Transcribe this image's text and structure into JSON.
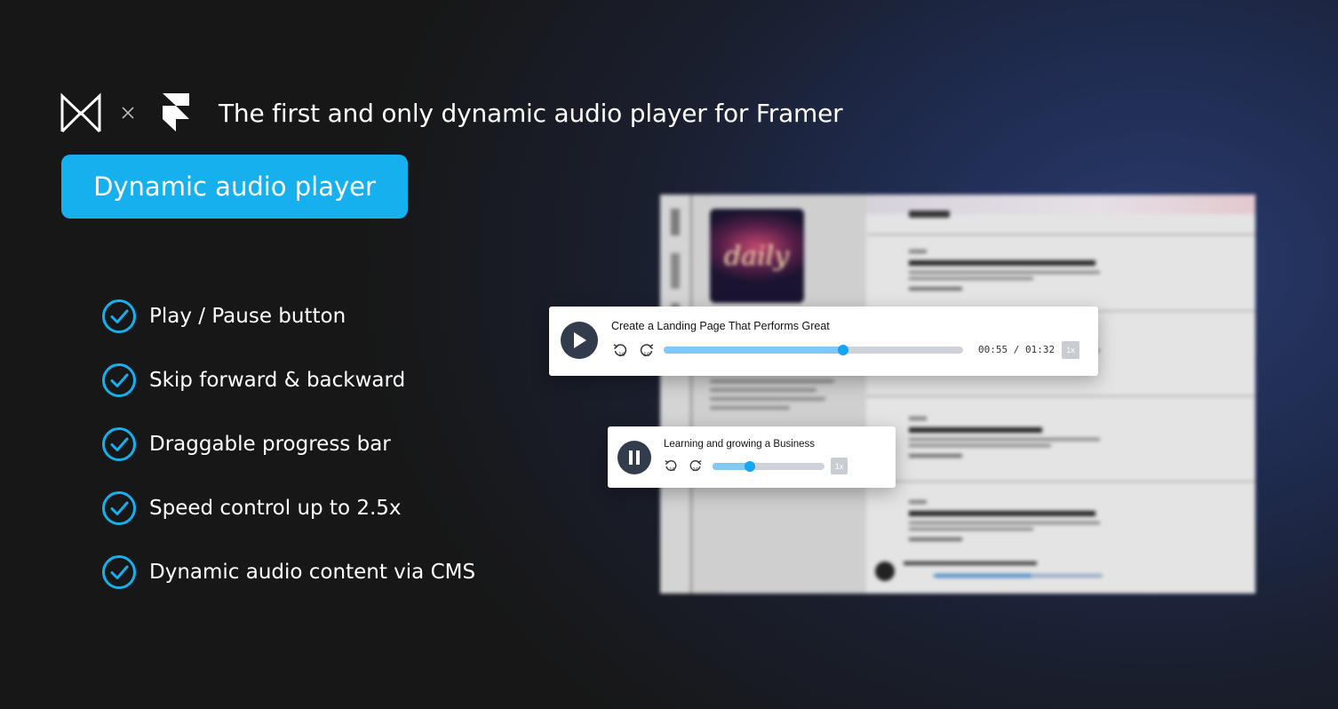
{
  "header": {
    "logo_brand_icon": "m-logo-icon",
    "separator_icon": "times-icon",
    "framer_logo_icon": "framer-logo-icon",
    "tagline": "The first and only dynamic audio player for Framer"
  },
  "badge": {
    "label": "Dynamic audio player",
    "color": "#16b0ef"
  },
  "features": [
    {
      "icon": "check-circle-icon",
      "label": "Play / Pause button"
    },
    {
      "icon": "check-circle-icon",
      "label": "Skip forward & backward"
    },
    {
      "icon": "check-circle-icon",
      "label": "Draggable progress bar"
    },
    {
      "icon": "check-circle-icon",
      "label": "Speed control up to 2.5x"
    },
    {
      "icon": "check-circle-icon",
      "label": "Dynamic audio content via CMS"
    }
  ],
  "player_main": {
    "title": "Create a Landing Page That Performs Great",
    "state": "paused",
    "button_icon": "play-icon",
    "progress": 0.6,
    "time": "00:55 / 01:32",
    "speed": "1x"
  },
  "player_secondary": {
    "title": "Learning and growing a Business",
    "state": "playing",
    "button_icon": "pause-icon",
    "progress": 0.33,
    "speed": "1x"
  },
  "mockup": {
    "cover_text": "daily"
  },
  "colors": {
    "accent": "#16b0ef",
    "progress_fill": "#82c8f4",
    "player_button": "#323c4c"
  }
}
